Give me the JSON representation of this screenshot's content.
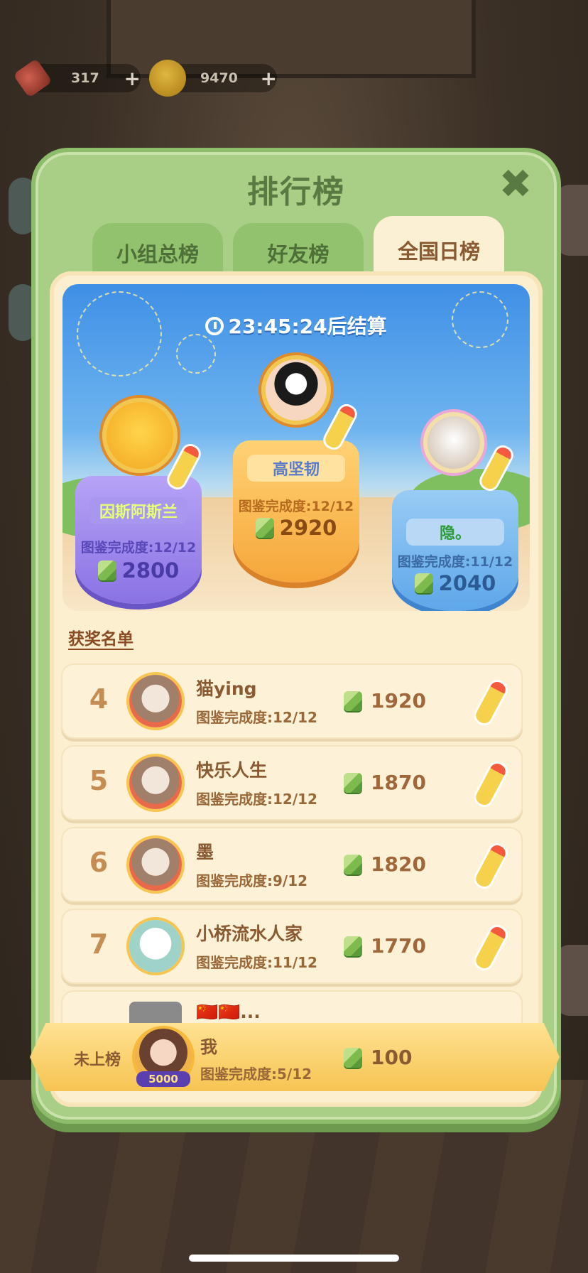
{
  "resources": [
    {
      "icon": "firecracker-icon",
      "value": "317",
      "plus": "+"
    },
    {
      "icon": "coin-icon",
      "value": "9470",
      "plus": "+"
    }
  ],
  "panel": {
    "title": "排行榜",
    "close": "✖",
    "tabs": [
      {
        "label": "小组总榜",
        "active": false
      },
      {
        "label": "好友榜",
        "active": false
      },
      {
        "label": "全国日榜",
        "active": true
      }
    ]
  },
  "timer": {
    "text": "23:45:24后结算"
  },
  "podium": {
    "second": {
      "name": "因斯阿斯兰",
      "progress": "图鉴完成度:12/12",
      "score": "2800"
    },
    "first": {
      "name": "高坚韧",
      "progress": "图鉴完成度:12/12",
      "score": "2920"
    },
    "third": {
      "name": "隐。",
      "progress": "图鉴完成度:11/12",
      "score": "2040"
    }
  },
  "awards_title": "获奖名单",
  "list": [
    {
      "rank": "4",
      "name": "猫ying",
      "progress": "图鉴完成度:12/12",
      "score": "1920"
    },
    {
      "rank": "5",
      "name": "快乐人生",
      "progress": "图鉴完成度:12/12",
      "score": "1870"
    },
    {
      "rank": "6",
      "name": "墨",
      "progress": "图鉴完成度:9/12",
      "score": "1820"
    },
    {
      "rank": "7",
      "name": "小桥流水人家",
      "progress": "图鉴完成度:11/12",
      "score": "1770"
    },
    {
      "rank": "",
      "name": "🇨🇳🇨🇳...",
      "progress": "",
      "score": ""
    }
  ],
  "me": {
    "status": "未上榜",
    "badge": "5000",
    "name": "我",
    "progress": "图鉴完成度:5/12",
    "score": "100"
  },
  "colors": {
    "panel_green": "#a9cf86",
    "title_green": "#5a7a44",
    "cream": "#fbefcf",
    "brown_text": "#8a5a32"
  }
}
